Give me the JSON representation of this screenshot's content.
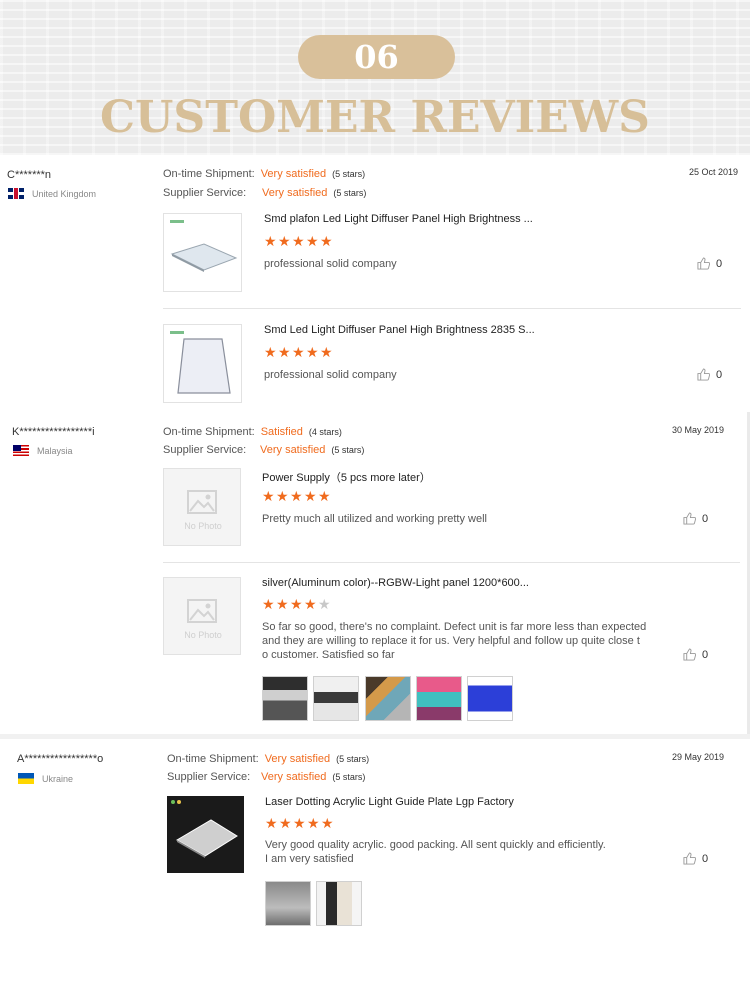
{
  "header": {
    "number": "06",
    "title": "CUSTOMER REVIEWS"
  },
  "labels": {
    "shipment": "On-time Shipment:",
    "service": "Supplier Service:",
    "no_photo": "No Photo"
  },
  "reviews": [
    {
      "user": "C*******n",
      "country": "United Kingdom",
      "flag": "uk",
      "date": "25 Oct 2019",
      "shipment": {
        "value": "Very satisfied",
        "count": "(5 stars)"
      },
      "service": {
        "value": "Very satisfied",
        "count": "(5 stars)"
      },
      "items": [
        {
          "title": "Smd plafon Led Light Diffuser Panel High Brightness ...",
          "rating": 5,
          "comment": "professional solid company",
          "likes": "0"
        },
        {
          "title": "Smd Led Light Diffuser Panel High Brightness 2835 S...",
          "rating": 5,
          "comment": "professional solid company",
          "likes": "0"
        }
      ]
    },
    {
      "user": "K*****************i",
      "country": "Malaysia",
      "flag": "my",
      "date": "30 May 2019",
      "shipment": {
        "value": "Satisfied",
        "count": "(4 stars)"
      },
      "service": {
        "value": "Very satisfied",
        "count": "(5 stars)"
      },
      "items": [
        {
          "title": "Power Supply（5 pcs more later）",
          "rating": 5,
          "comment": "Pretty much all utilized and working pretty well",
          "likes": "0"
        },
        {
          "title": "silver(Aluminum color)--RGBW-Light panel 1200*600...",
          "rating": 4,
          "comment_lines": [
            "So far so good, there's no complaint. Defect unit is far more less than expected",
            "and they are willing to replace it for us. Very helpful and follow up quite close t",
            "o customer. Satisfied so far"
          ],
          "likes": "0"
        }
      ]
    },
    {
      "user": "A*****************o",
      "country": "Ukraine",
      "flag": "ua",
      "date": "29 May 2019",
      "shipment": {
        "value": "Very satisfied",
        "count": "(5 stars)"
      },
      "service": {
        "value": "Very satisfied",
        "count": "(5 stars)"
      },
      "items": [
        {
          "title": "Laser Dotting Acrylic Light Guide Plate Lgp Factory",
          "rating": 5,
          "comment_lines": [
            "Very good quality acrylic. good packing. All sent quickly and efficiently.",
            "I am very satisfied"
          ],
          "likes": "0"
        }
      ]
    }
  ],
  "colors": {
    "accent": "#f06b1e",
    "gold": "#d7bf98"
  }
}
